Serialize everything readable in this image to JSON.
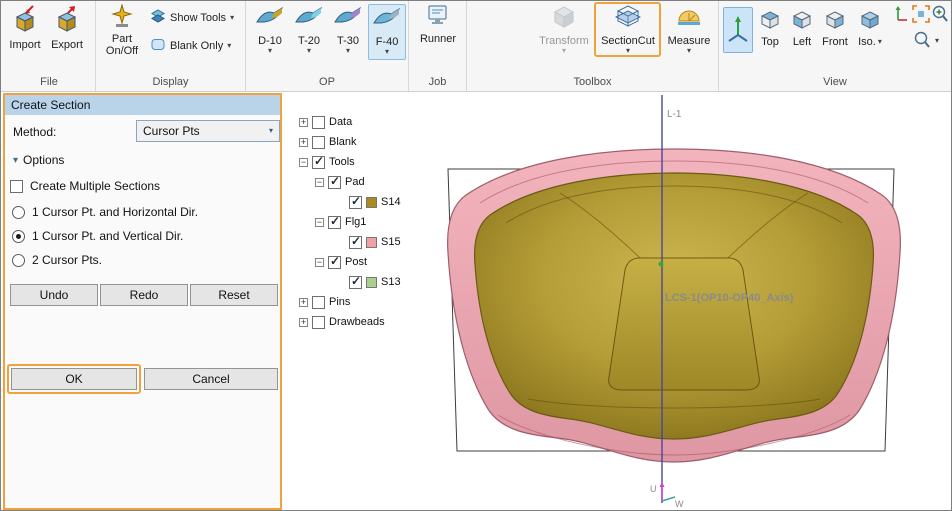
{
  "ribbon": {
    "groups": {
      "file": {
        "label": "File",
        "import": "Import",
        "export": "Export"
      },
      "display": {
        "label": "Display",
        "part_line1": "Part",
        "part_line2": "On/Off",
        "show_tools": "Show Tools",
        "blank_only": "Blank Only"
      },
      "op": {
        "label": "OP",
        "d10": "D-10",
        "t20": "T-20",
        "t30": "T-30",
        "f40": "F-40"
      },
      "job": {
        "label": "Job",
        "runner": "Runner"
      },
      "toolbox": {
        "label": "Toolbox",
        "transform": "Transform",
        "sectioncut": "SectionCut",
        "measure": "Measure"
      },
      "view": {
        "label": "View",
        "top": "Top",
        "left": "Left",
        "front": "Front",
        "iso": "Iso."
      }
    }
  },
  "panel": {
    "title": "Create Section",
    "method_label": "Method:",
    "method_value": "Cursor Pts",
    "options_label": "Options",
    "create_multiple_label": "Create Multiple Sections",
    "create_multiple_checked": false,
    "radios": [
      {
        "label": "1 Cursor Pt. and Horizontal Dir.",
        "selected": false
      },
      {
        "label": "1 Cursor Pt. and Vertical Dir.",
        "selected": true
      },
      {
        "label": "2 Cursor Pts.",
        "selected": false
      }
    ],
    "undo_label": "Undo",
    "redo_label": "Redo",
    "reset_label": "Reset",
    "ok_label": "OK",
    "cancel_label": "Cancel"
  },
  "tree": {
    "items": [
      {
        "label": "Data",
        "expand": "+",
        "checked": false,
        "level": 0
      },
      {
        "label": "Blank",
        "expand": "+",
        "checked": false,
        "level": 0
      },
      {
        "label": "Tools",
        "expand": "−",
        "checked": true,
        "level": 0
      },
      {
        "label": "Pad",
        "expand": "−",
        "checked": true,
        "level": 1
      },
      {
        "label": "S14",
        "checked": true,
        "level": 2,
        "swatch": "#A98B20"
      },
      {
        "label": "Flg1",
        "expand": "−",
        "checked": true,
        "level": 1
      },
      {
        "label": "S15",
        "checked": true,
        "level": 2,
        "swatch": "#F2A0A8"
      },
      {
        "label": "Post",
        "expand": "−",
        "checked": true,
        "level": 1
      },
      {
        "label": "S13",
        "checked": true,
        "level": 2,
        "swatch": "#A9D18E"
      },
      {
        "label": "Pins",
        "expand": "+",
        "checked": false,
        "level": 0
      },
      {
        "label": "Drawbeads",
        "expand": "+",
        "checked": false,
        "level": 0
      }
    ]
  },
  "viewport": {
    "line_label": "L-1",
    "lcs_label": "LCS-1(OP10-OP40_Axis)",
    "axis_u": "U",
    "axis_w": "W"
  },
  "icons": {
    "caret": "▾"
  },
  "colors": {
    "highlight": "#F0A23C",
    "gold": "#B29A2E",
    "pink": "#ECA9B2",
    "title_bar": "#B9D3E9",
    "op_selected": "#D9EAF7"
  }
}
